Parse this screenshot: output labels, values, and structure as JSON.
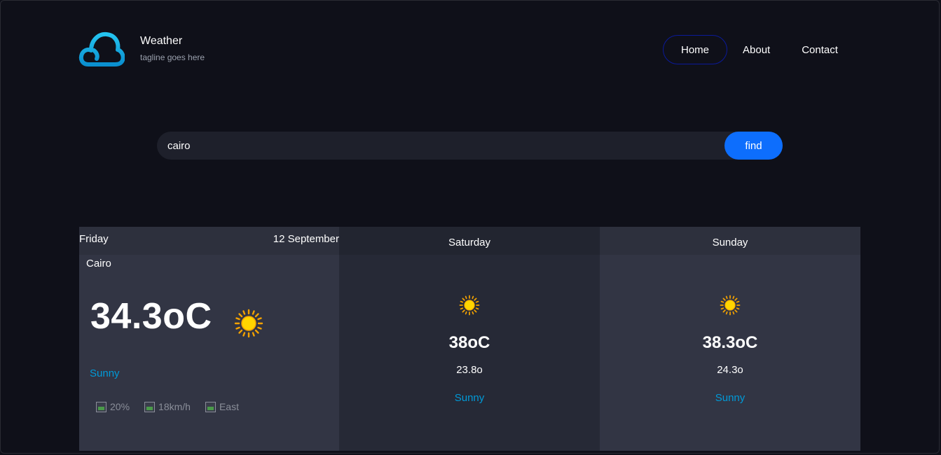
{
  "brand": {
    "title": "Weather",
    "tagline": "tagline goes here"
  },
  "nav": {
    "home": "Home",
    "about": "About",
    "contact": "Contact"
  },
  "search": {
    "value": "cairo",
    "button": "find"
  },
  "today": {
    "day": "Friday",
    "date": "12 September",
    "city": "Cairo",
    "temp": "34.3oC",
    "condition": "Sunny",
    "humidity": "20%",
    "wind": "18km/h",
    "direction": "East"
  },
  "forecast": [
    {
      "day": "Saturday",
      "max": "38oC",
      "min": "23.8o",
      "condition": "Sunny"
    },
    {
      "day": "Sunday",
      "max": "38.3oC",
      "min": "24.3o",
      "condition": "Sunny"
    }
  ],
  "colors": {
    "accent": "#009ad8",
    "button": "#0d6efd",
    "background": "#0f1019",
    "card": "#323544"
  },
  "icons": {
    "logo": "cloud-icon",
    "weather": "sun-icon"
  }
}
